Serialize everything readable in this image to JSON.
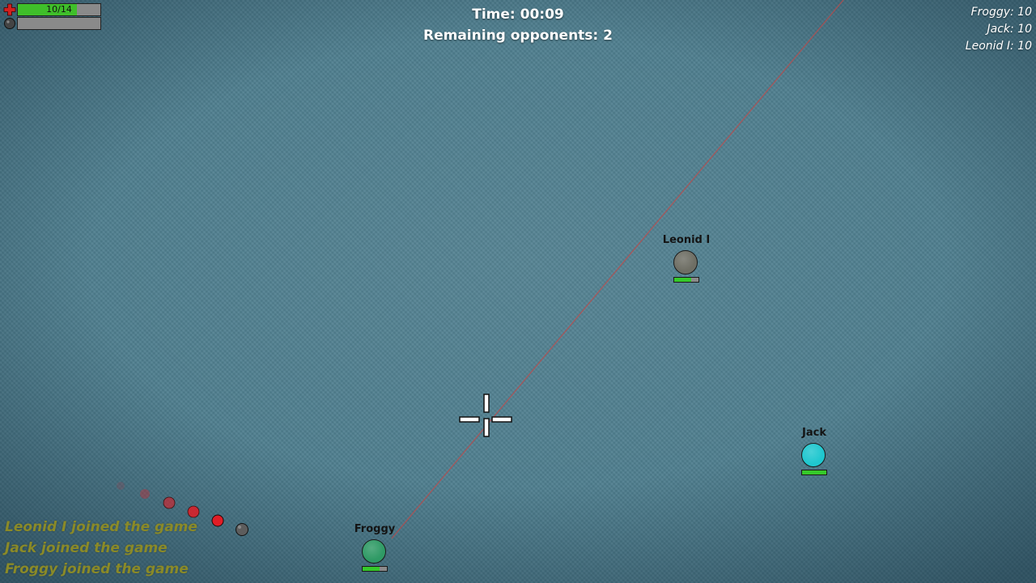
{
  "hud": {
    "health": {
      "current": 10,
      "max": 14,
      "label": "10/14",
      "icon": "health-cross-icon",
      "color": "#3fbf2a"
    },
    "ammo": {
      "icon": "bomb-icon",
      "fill": 0.0
    }
  },
  "match": {
    "time_label": "Time: 00:09",
    "remaining_label": "Remaining opponents: 2"
  },
  "scoreboard": [
    {
      "text": "Froggy: 10"
    },
    {
      "text": "Jack: 10"
    },
    {
      "text": "Leonid I: 10"
    }
  ],
  "players": [
    {
      "name": "Leonid I",
      "color": "#6e6e64",
      "health": 0.7
    },
    {
      "name": "Jack",
      "color": "#1fc7cf",
      "health": 1.0
    },
    {
      "name": "Froggy",
      "color": "#2f9a65",
      "health": 0.7
    }
  ],
  "event_log": [
    {
      "text": "Leonid I joined the game"
    },
    {
      "text": "Jack joined the game"
    },
    {
      "text": "Froggy joined the game"
    }
  ],
  "colors": {
    "background": "#4f7f8f",
    "aim_line": "#c04848",
    "trail": "#e01d26",
    "log_text": "#8a8a28"
  }
}
